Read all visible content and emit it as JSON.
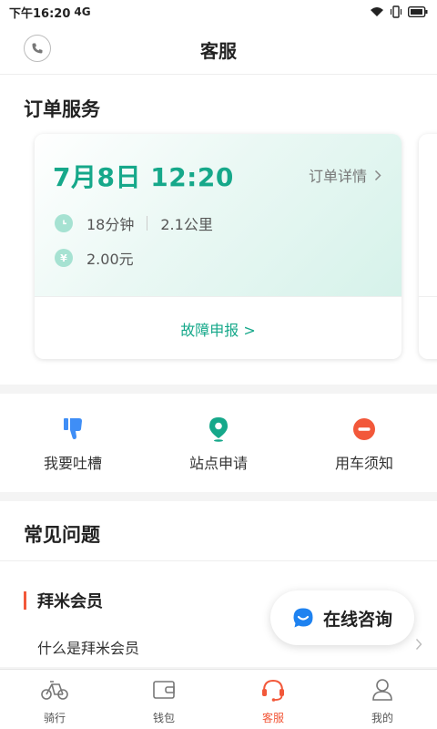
{
  "status_bar": {
    "time": "下午16:20",
    "network": "4G"
  },
  "nav": {
    "title": "客服"
  },
  "order_service": {
    "title": "订单服务",
    "card": {
      "date": "7月8日 12:20",
      "detail_link": "订单详情",
      "duration": "18分钟",
      "distance": "2.1公里",
      "price": "2.00元",
      "fault_report": "故障申报 >"
    }
  },
  "quick_actions": [
    {
      "label": "我要吐槽",
      "icon": "thumbs-down-icon",
      "color": "#3f8ef6"
    },
    {
      "label": "站点申请",
      "icon": "map-pin-icon",
      "color": "#16a88a"
    },
    {
      "label": "用车须知",
      "icon": "no-entry-icon",
      "color": "#f2583a"
    }
  ],
  "faq": {
    "title": "常见问题",
    "category": "拜米会员",
    "question": "什么是拜米会员"
  },
  "online_consult": {
    "label": "在线咨询"
  },
  "tab_bar": [
    {
      "label": "骑行",
      "icon": "bike-icon",
      "active": false
    },
    {
      "label": "钱包",
      "icon": "wallet-icon",
      "active": false
    },
    {
      "label": "客服",
      "icon": "headset-icon",
      "active": true
    },
    {
      "label": "我的",
      "icon": "user-icon",
      "active": false
    }
  ],
  "colors": {
    "accent": "#16a88a",
    "active_tab": "#f2583a",
    "chat": "#1e82f0"
  }
}
